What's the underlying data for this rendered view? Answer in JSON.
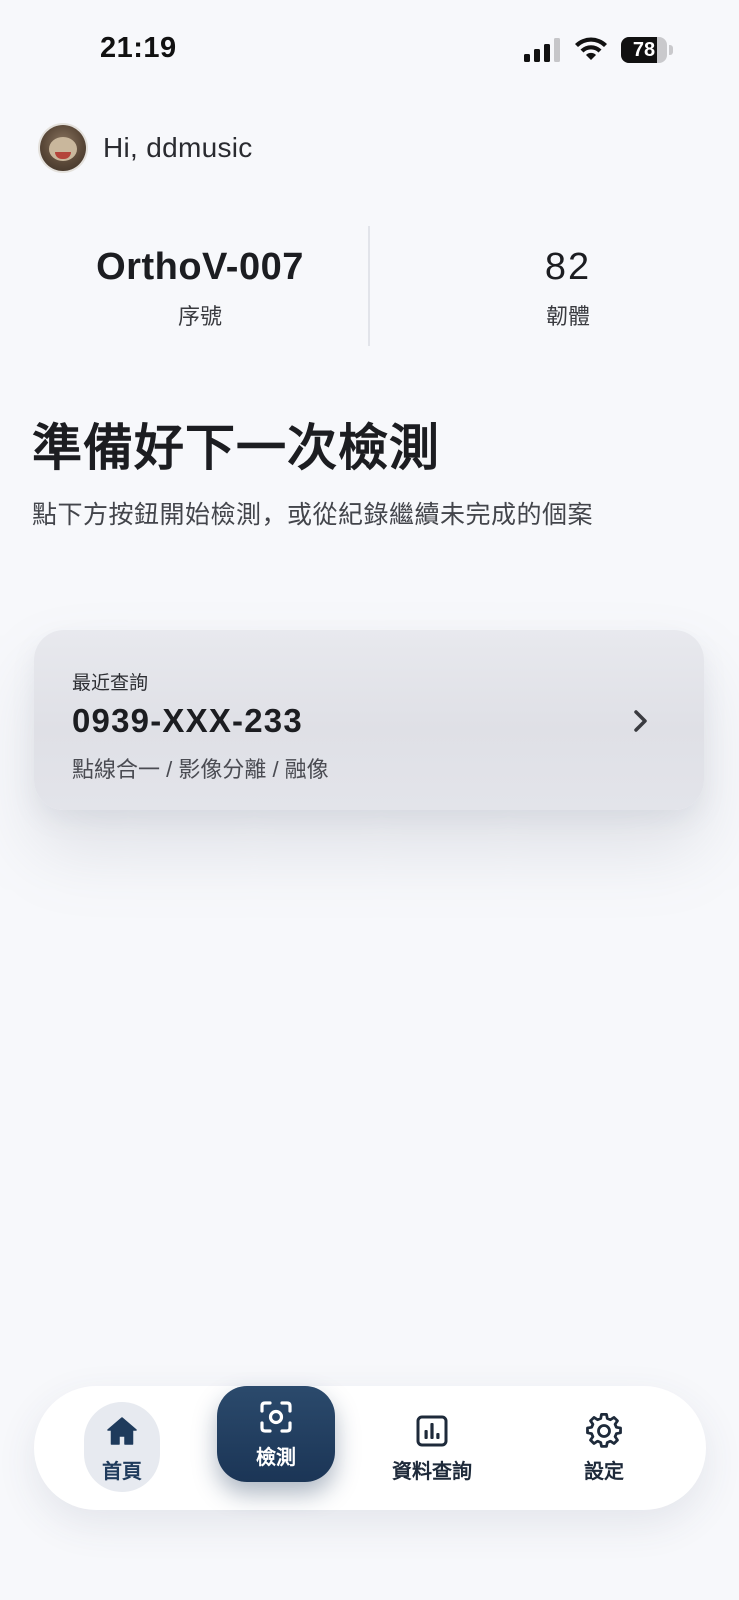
{
  "status_bar": {
    "time": "21:19",
    "battery_level": "78",
    "battery_fraction": 0.78
  },
  "header": {
    "greeting": "Hi, ddmusic"
  },
  "stats": {
    "serial_value": "OrthoV-007",
    "serial_label": "序號",
    "firmware_value": "82",
    "firmware_label": "韌體"
  },
  "hero": {
    "title": "準備好下一次檢測",
    "subtitle": "點下方按鈕開始檢測，或從紀錄繼續未完成的個案"
  },
  "recent": {
    "label": "最近查詢",
    "phone": "0939-XXX-233",
    "methods": "點線合一 / 影像分離 / 融像"
  },
  "tab_bar": {
    "home_label": "首頁",
    "detect_label": "檢測",
    "data_label": "資料查詢",
    "settings_label": "設定"
  },
  "colors": {
    "accent": "#1f3b5c",
    "background": "#f7f8fb"
  },
  "icons": [
    "signal-icon",
    "wifi-icon",
    "battery-icon",
    "chevron-right-icon",
    "home-icon",
    "scan-icon",
    "chart-icon",
    "gear-icon"
  ]
}
